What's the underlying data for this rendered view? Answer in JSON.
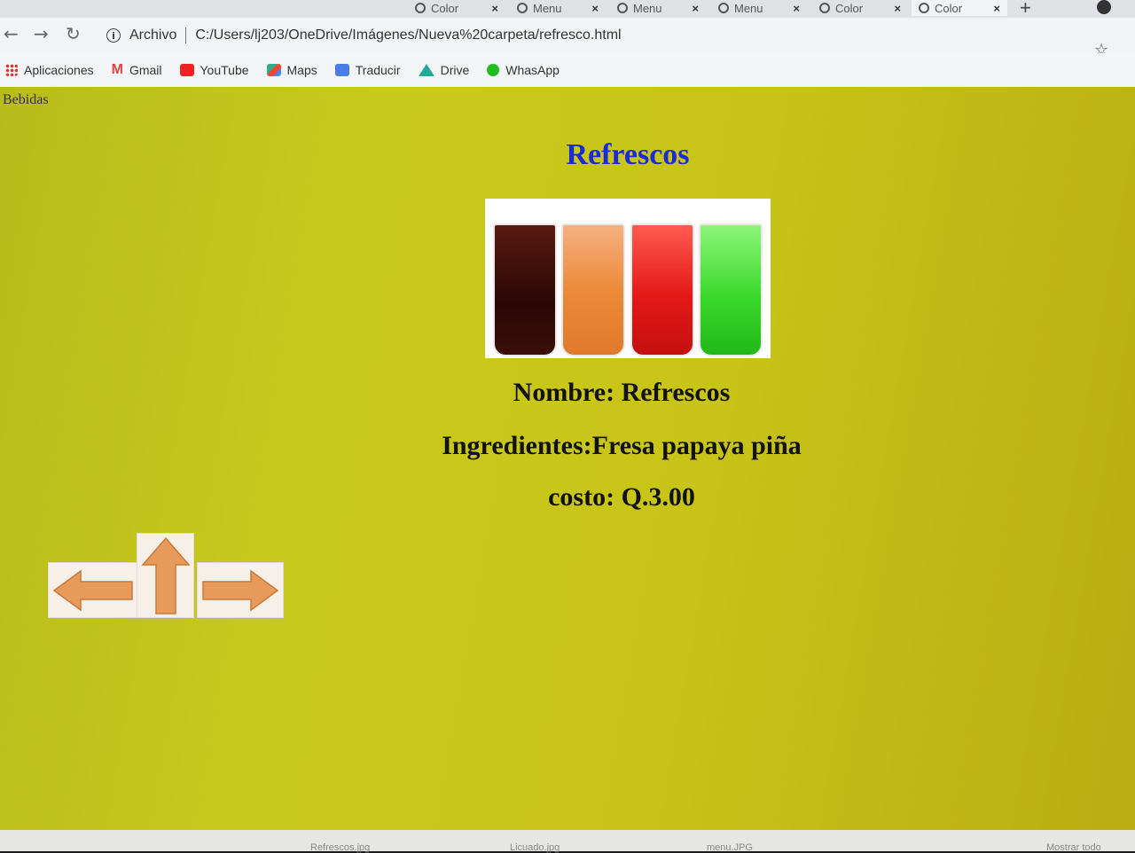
{
  "browser": {
    "tabs": [
      {
        "label": "Color"
      },
      {
        "label": "Menu"
      },
      {
        "label": "Menu"
      },
      {
        "label": "Menu"
      },
      {
        "label": "Color"
      },
      {
        "label": "Color"
      }
    ],
    "new_tab_label": "+",
    "address": {
      "security_label": "Archivo",
      "url": "C:/Users/lj203/OneDrive/Imágenes/Nueva%20carpeta/refresco.html"
    },
    "bookmarks": [
      {
        "label": "Aplicaciones",
        "icon": "apps-icon"
      },
      {
        "label": "Gmail",
        "icon": "gmail-icon"
      },
      {
        "label": "YouTube",
        "icon": "youtube-icon"
      },
      {
        "label": "Maps",
        "icon": "maps-icon"
      },
      {
        "label": "Traducir",
        "icon": "translate-icon"
      },
      {
        "label": "Drive",
        "icon": "drive-icon"
      },
      {
        "label": "WhasApp",
        "icon": "whatsapp-icon"
      }
    ]
  },
  "page": {
    "breadcrumb": "Bebidas",
    "title": "Refrescos",
    "name_line": "Nombre: Refrescos",
    "ingredients_line": "Ingredientes:Fresa papaya piña",
    "cost_line": "costo: Q.3.00",
    "image_icon": "drinks-photo",
    "nav_arrows": [
      "arrow-left-icon",
      "arrow-up-icon",
      "arrow-right-icon"
    ]
  },
  "status_bar": {
    "downloads": [
      "Refrescos.jpg",
      "Licuado.jpg",
      "menu.JPG"
    ],
    "show_all": "Mostrar todo"
  },
  "colors": {
    "page_background": "#c6c41a",
    "title": "#1a2bd8",
    "text": "#111111"
  }
}
